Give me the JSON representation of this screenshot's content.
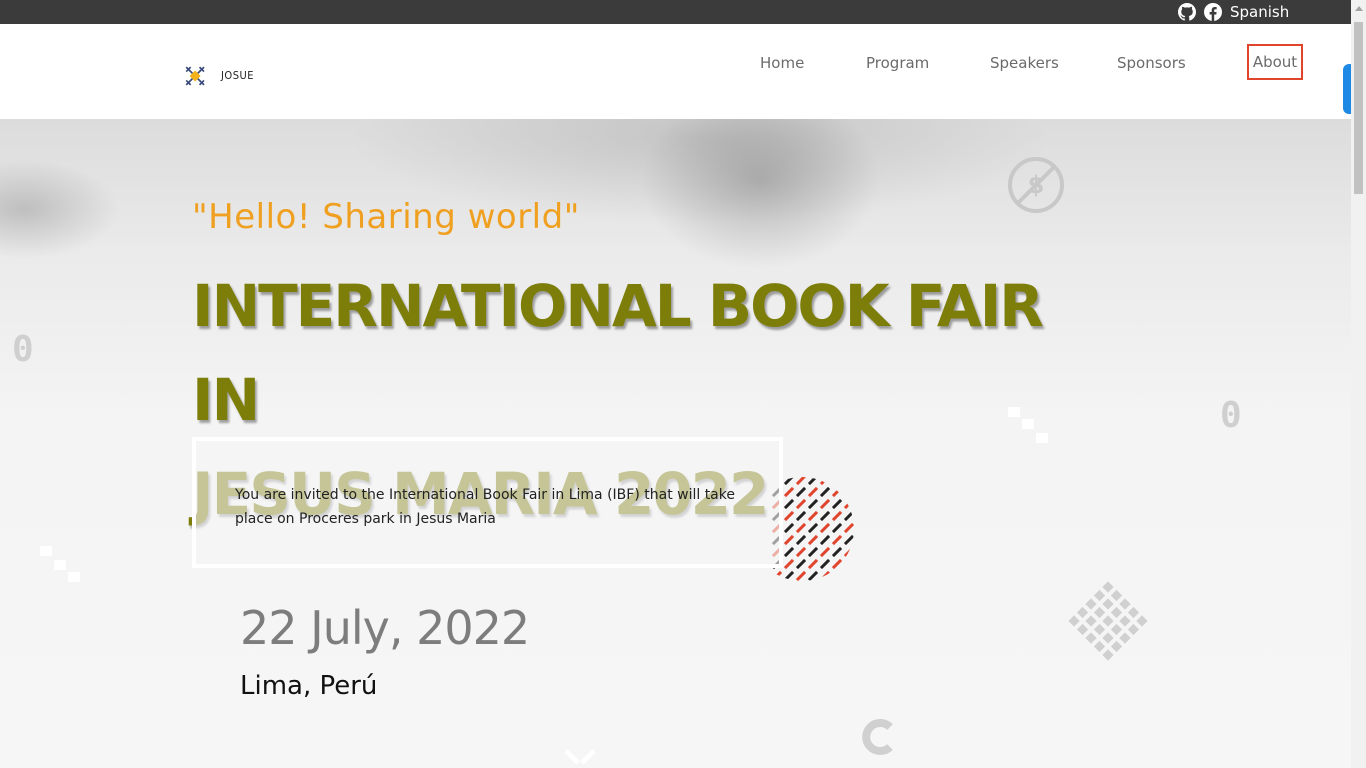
{
  "topbar": {
    "github_icon": "github-icon",
    "facebook_icon": "facebook-icon",
    "language": "Spanish"
  },
  "brand": {
    "logo_text": "JOSUE"
  },
  "nav": {
    "items": [
      "Home",
      "Program",
      "Speakers",
      "Sponsors",
      "About"
    ],
    "active": "About",
    "active_border_color": "#e0442c"
  },
  "hero": {
    "tagline": "\"Hello! Sharing world\"",
    "title_line1": "INTERNATIONAL BOOK FAIR IN",
    "title_line2": "JESUS MARIA 2022",
    "invitation": "You are invited to the International Book Fair in Lima (IBF) that will take place on Proceres park in Jesus Maria",
    "date": "22 July, 2022",
    "location": "Lima, Perú"
  },
  "colors": {
    "tagline": "#f0a020",
    "title": "#7d7d0a",
    "topbar": "#3b3b3b",
    "accent_pill": "#1e88e5"
  }
}
